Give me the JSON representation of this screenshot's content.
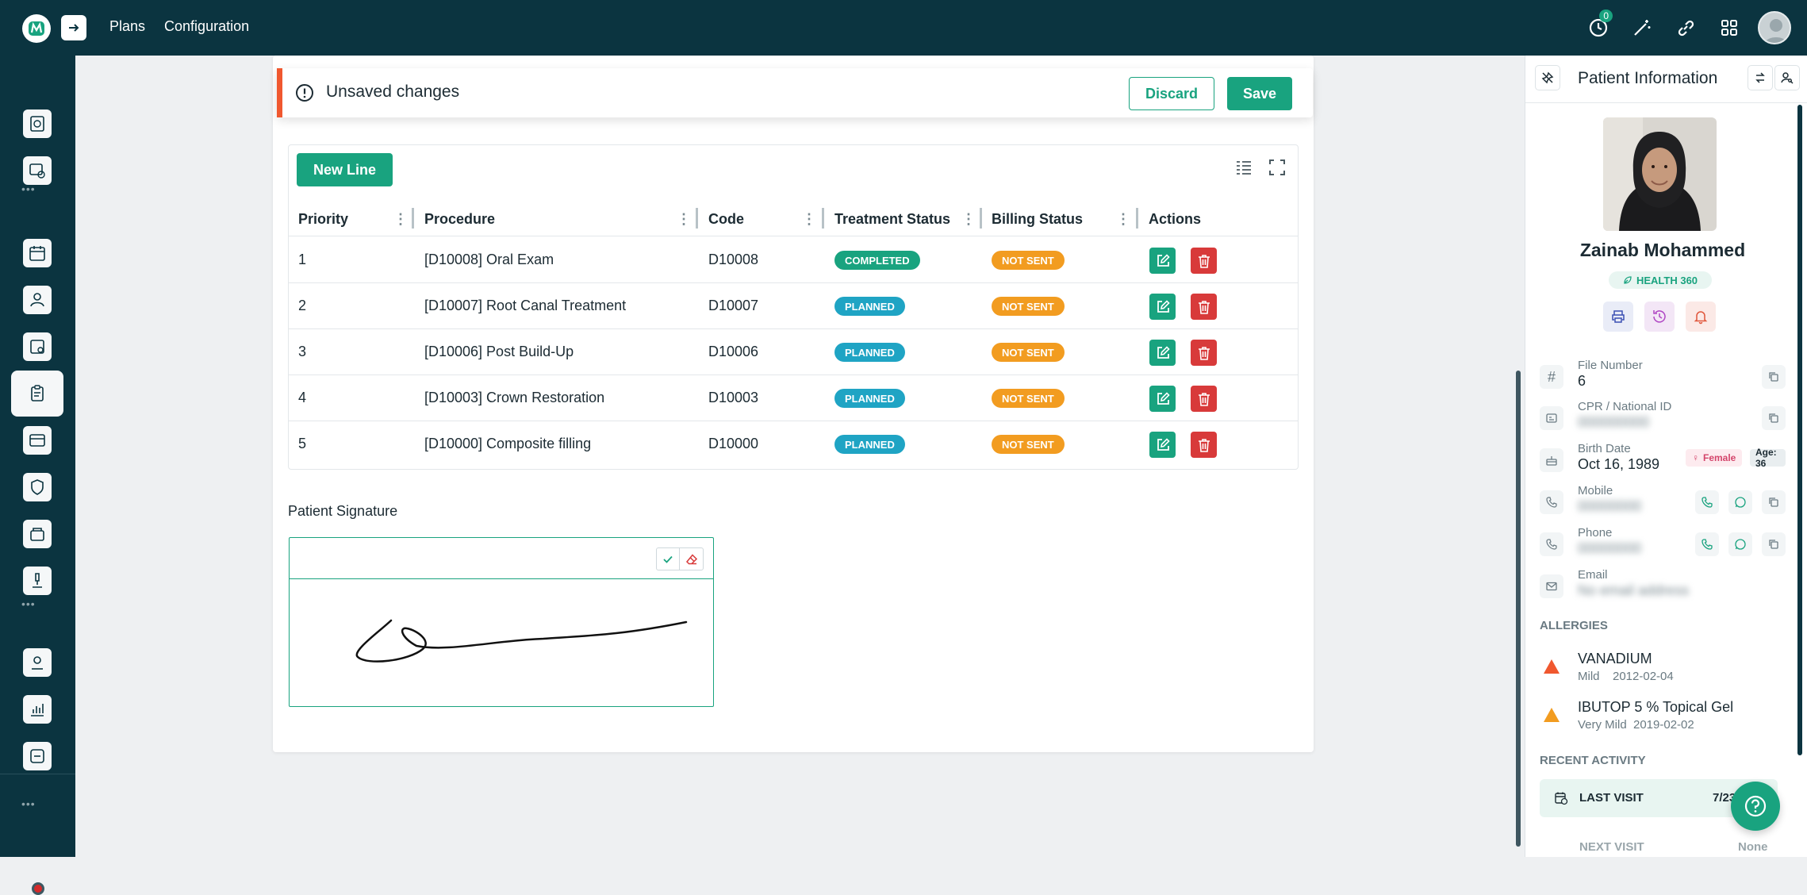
{
  "nav": {
    "items": [
      "Plans",
      "Configuration"
    ]
  },
  "topbar": {
    "notification_count": "0"
  },
  "unsaved": {
    "title": "Unsaved changes",
    "discard": "Discard",
    "save": "Save"
  },
  "table": {
    "new_line": "New Line",
    "columns": [
      "Priority",
      "Procedure",
      "Code",
      "Treatment Status",
      "Billing Status",
      "Actions"
    ],
    "rows": [
      {
        "priority": "1",
        "procedure": "[D10008] Oral Exam",
        "code": "D10008",
        "treatment": "COMPLETED",
        "billing": "NOT SENT"
      },
      {
        "priority": "2",
        "procedure": "[D10007] Root Canal Treatment",
        "code": "D10007",
        "treatment": "PLANNED",
        "billing": "NOT SENT"
      },
      {
        "priority": "3",
        "procedure": "[D10006] Post Build-Up",
        "code": "D10006",
        "treatment": "PLANNED",
        "billing": "NOT SENT"
      },
      {
        "priority": "4",
        "procedure": "[D10003] Crown Restoration",
        "code": "D10003",
        "treatment": "PLANNED",
        "billing": "NOT SENT"
      },
      {
        "priority": "5",
        "procedure": "[D10000] Composite filling",
        "code": "D10000",
        "treatment": "PLANNED",
        "billing": "NOT SENT"
      }
    ]
  },
  "signature": {
    "label": "Patient Signature"
  },
  "patient": {
    "panel_title": "Patient Information",
    "name": "Zainab Mohammed",
    "badge": "HEALTH 360",
    "file_number_label": "File Number",
    "file_number": "6",
    "cpr_label": "CPR / National ID",
    "cpr_value": "000000000",
    "birth_label": "Birth Date",
    "birth_date": "Oct 16, 1989",
    "gender": "Female",
    "age": "Age: 36",
    "mobile_label": "Mobile",
    "mobile_value": "00000000",
    "phone_label": "Phone",
    "phone_value": "00000000",
    "email_label": "Email",
    "email_value": "No email address",
    "allergies_title": "ALLERGIES",
    "allergies": [
      {
        "name": "VANADIUM",
        "severity": "Mild",
        "date": "2012-02-04",
        "color": "#f0582f"
      },
      {
        "name": "IBUTOP 5 % Topical Gel",
        "severity": "Very Mild",
        "date": "2019-02-02",
        "color": "#f29c20"
      }
    ],
    "recent_title": "RECENT ACTIVITY",
    "last_visit_label": "LAST VISIT",
    "last_visit_value": "7/23",
    "next_visit_label": "NEXT VISIT",
    "next_visit_value": "None"
  },
  "colors": {
    "brand": "#0b3440",
    "accent": "#19a37f",
    "danger": "#d83a3a",
    "warning": "#f29c20",
    "info": "#1fa4c4"
  }
}
